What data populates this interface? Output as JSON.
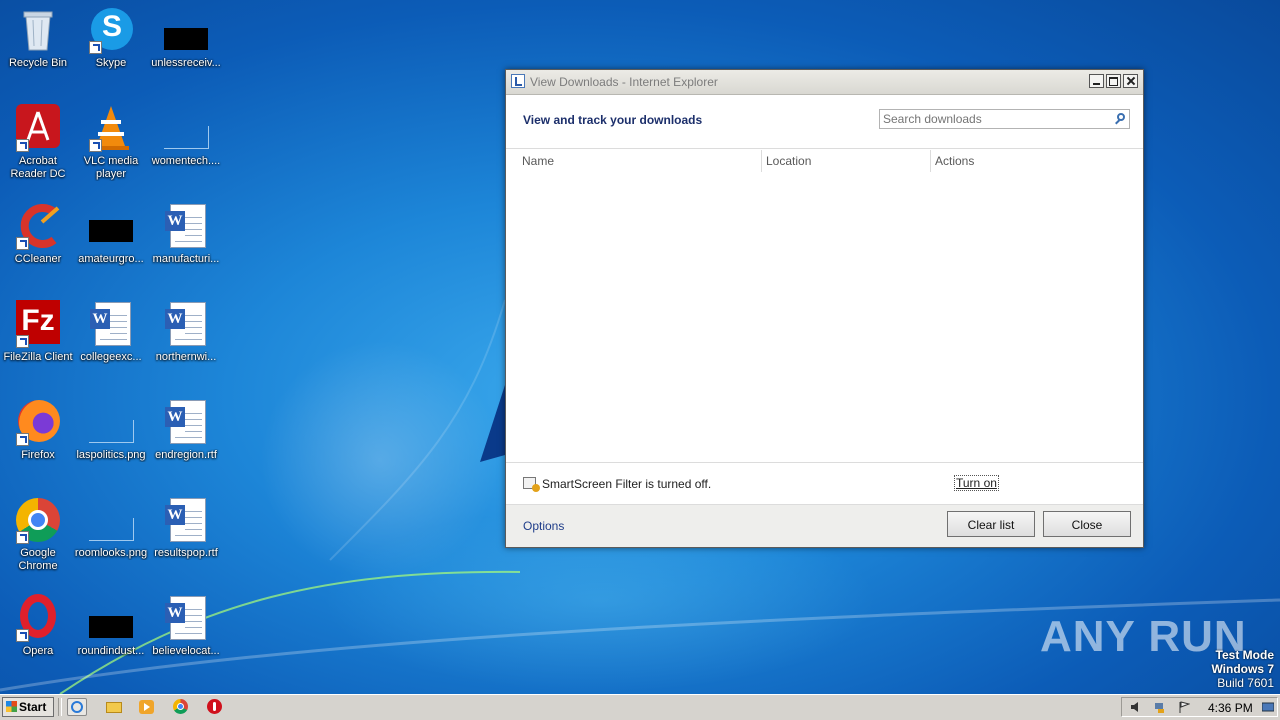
{
  "desktop": {
    "icons": [
      {
        "label": "Recycle Bin"
      },
      {
        "label": "Skype"
      },
      {
        "label": "unlessreceiv..."
      },
      {
        "label": "Acrobat Reader DC"
      },
      {
        "label": "VLC media player"
      },
      {
        "label": "womentech...."
      },
      {
        "label": "CCleaner"
      },
      {
        "label": "amateurgro..."
      },
      {
        "label": "manufacturi..."
      },
      {
        "label": "FileZilla Client"
      },
      {
        "label": "collegeexc..."
      },
      {
        "label": "northernwi..."
      },
      {
        "label": "Firefox"
      },
      {
        "label": "laspolitics.png"
      },
      {
        "label": "endregion.rtf"
      },
      {
        "label": "Google Chrome"
      },
      {
        "label": "roomlooks.png"
      },
      {
        "label": "resultspop.rtf"
      },
      {
        "label": "Opera"
      },
      {
        "label": "roundindust..."
      },
      {
        "label": "believelocat..."
      }
    ]
  },
  "dialog": {
    "title": "View Downloads - Internet Explorer",
    "heading": "View and track your downloads",
    "search_placeholder": "Search downloads",
    "columns": [
      "Name",
      "Location",
      "Actions"
    ],
    "smartscreen_text": "SmartScreen Filter is turned off.",
    "turn_on": "Turn on",
    "options": "Options",
    "clear_list": "Clear list",
    "close": "Close"
  },
  "watermark": {
    "text": "ANY RUN",
    "test_mode": "Test Mode",
    "os": "Windows 7",
    "build": "Build 7601"
  },
  "taskbar": {
    "start": "Start",
    "clock": "4:36 PM",
    "pinned": [
      "internet-explorer-icon",
      "explorer-icon",
      "media-player-icon",
      "chrome-icon",
      "opera-icon"
    ]
  },
  "colors": {
    "wallpaper": "#1d86d8",
    "heading_text": "#1c2f6b",
    "link": "#1f3d8a"
  }
}
